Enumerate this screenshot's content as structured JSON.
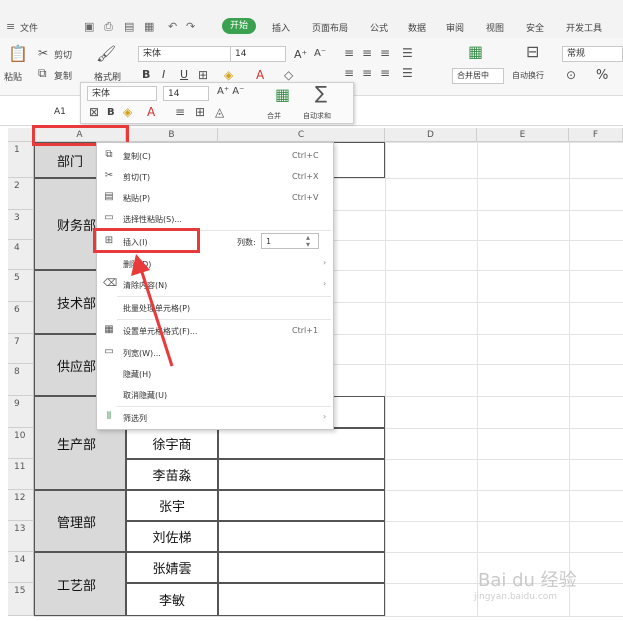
{
  "menubar": {
    "file": "文件",
    "tabs": [
      "开始",
      "插入",
      "页面布局",
      "公式",
      "数据",
      "审阅",
      "视图",
      "安全",
      "开发工具"
    ]
  },
  "ribbon": {
    "paste": "粘贴",
    "cut": "剪切",
    "copy": "复制",
    "format_painter": "格式刷",
    "font_name": "宋体",
    "font_size": "14",
    "merge_center": "合并居中",
    "wrap": "自动换行",
    "number_format": "常规",
    "bold": "B",
    "italic": "I",
    "underline": "U",
    "grow": "A⁺",
    "shrink": "A⁻",
    "percent": "%"
  },
  "mini_toolbar": {
    "font_name": "宋体",
    "font_size": "14",
    "merge": "合并",
    "autosum": "自动求和"
  },
  "namebox": "A1",
  "columns": [
    "A",
    "B",
    "C",
    "D",
    "E",
    "F"
  ],
  "rows": [
    "1",
    "2",
    "3",
    "4",
    "5",
    "6",
    "7",
    "8",
    "9",
    "10",
    "11",
    "12",
    "13",
    "14",
    "15"
  ],
  "departments": [
    "部门",
    "财务部",
    "技术部",
    "供应部",
    "生产部",
    "管理部",
    "工艺部"
  ],
  "names": [
    "徐宇商",
    "李苗淼",
    "张宇",
    "刘佐梯",
    "张婧雲",
    "李敏"
  ],
  "context_menu": {
    "items": [
      {
        "label": "复制(C)",
        "shortcut": "Ctrl+C",
        "icon": "copy-icon"
      },
      {
        "label": "剪切(T)",
        "shortcut": "Ctrl+X",
        "icon": "cut-icon"
      },
      {
        "label": "粘贴(P)",
        "shortcut": "Ctrl+V",
        "icon": "paste-icon"
      },
      {
        "label": "选择性粘贴(S)...",
        "shortcut": "",
        "icon": "paste-special-icon"
      },
      {
        "label": "插入(I)",
        "shortcut": "",
        "icon": "insert-icon"
      },
      {
        "label": "删除(D)",
        "shortcut": "",
        "icon": ""
      },
      {
        "label": "清除内容(N)",
        "shortcut": "",
        "icon": "eraser-icon"
      },
      {
        "label": "批量处理单元格(P)",
        "shortcut": "",
        "icon": ""
      },
      {
        "label": "设置单元格格式(F)...",
        "shortcut": "Ctrl+1",
        "icon": "format-cells-icon"
      },
      {
        "label": "列宽(W)...",
        "shortcut": "",
        "icon": "column-width-icon"
      },
      {
        "label": "隐藏(H)",
        "shortcut": "",
        "icon": ""
      },
      {
        "label": "取消隐藏(U)",
        "shortcut": "",
        "icon": ""
      },
      {
        "label": "筛选列",
        "shortcut": "",
        "icon": "filter-icon"
      }
    ],
    "insert_count_label": "列数:",
    "insert_count_value": "1"
  },
  "watermark": {
    "brand": "Bai du 经验",
    "url": "jingyan.baidu.com"
  },
  "colors": {
    "accent_green": "#3aa14f",
    "highlight_red": "#e83a3a",
    "header_gray": "#eeeeee",
    "dept_fill": "#d9d9d9"
  }
}
